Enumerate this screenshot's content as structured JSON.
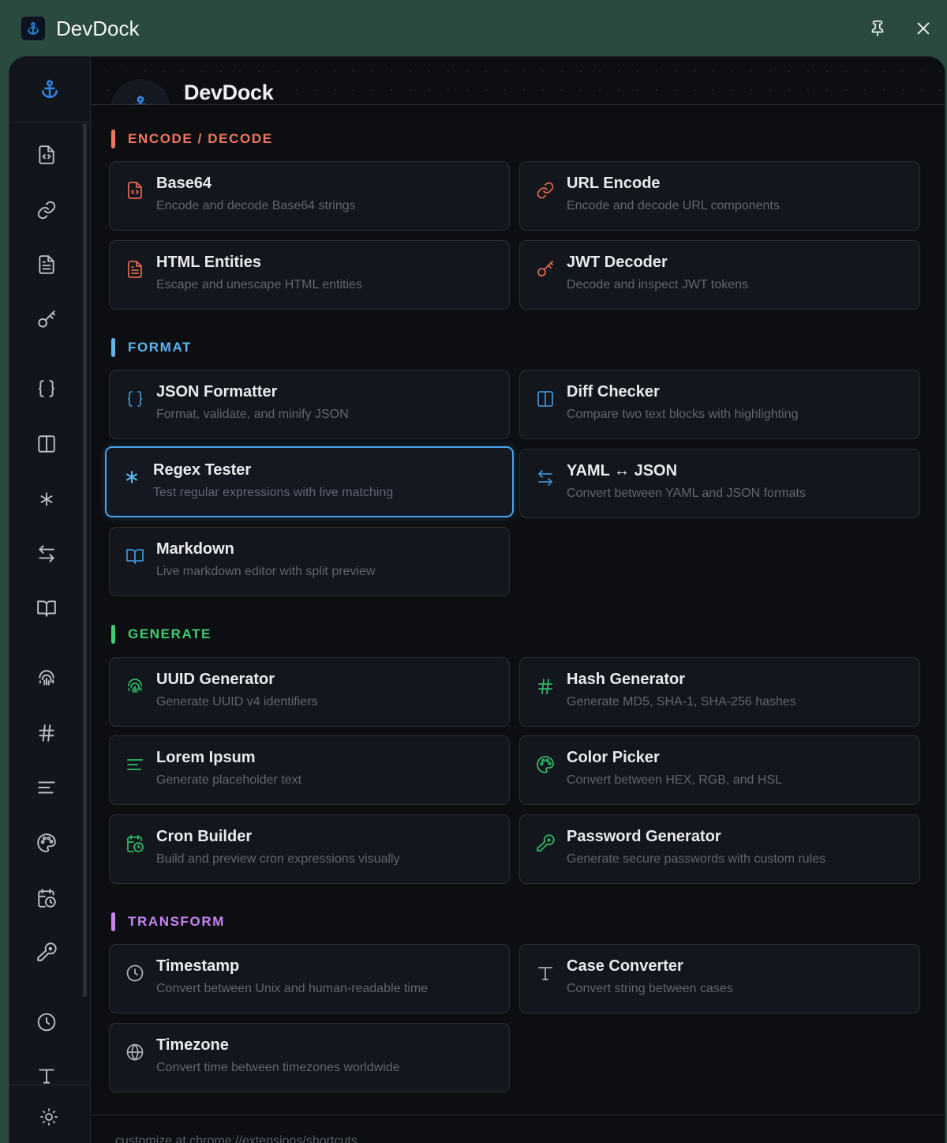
{
  "window": {
    "title": "DevDock",
    "pin_icon": "pin-icon",
    "close_icon": "close-icon"
  },
  "header": {
    "title": "DevDock"
  },
  "sections": {
    "encode": {
      "label": "ENCODE / DECODE",
      "color": "#f0775e"
    },
    "format": {
      "label": "FORMAT",
      "color": "#5cb8f2"
    },
    "generate": {
      "label": "GENERATE",
      "color": "#3ecf70"
    },
    "transform": {
      "label": "TRANSFORM",
      "color": "#c983f3"
    }
  },
  "tools": {
    "base64": {
      "title": "Base64",
      "desc": "Encode and decode Base64 strings",
      "icon": "file-code-icon"
    },
    "url": {
      "title": "URL Encode",
      "desc": "Encode and decode URL components",
      "icon": "link-icon"
    },
    "html": {
      "title": "HTML Entities",
      "desc": "Escape and unescape HTML entities",
      "icon": "file-text-icon"
    },
    "jwt": {
      "title": "JWT Decoder",
      "desc": "Decode and inspect JWT tokens",
      "icon": "key-icon"
    },
    "json": {
      "title": "JSON Formatter",
      "desc": "Format, validate, and minify JSON",
      "icon": "braces-icon"
    },
    "diff": {
      "title": "Diff Checker",
      "desc": "Compare two text blocks with highlighting",
      "icon": "columns-icon"
    },
    "regex": {
      "title": "Regex Tester",
      "desc": "Test regular expressions with live matching",
      "icon": "asterisk-icon"
    },
    "yaml": {
      "title": "YAML ↔ JSON",
      "desc": "Convert between YAML and JSON formats",
      "icon": "arrows-swap-icon"
    },
    "markdown": {
      "title": "Markdown",
      "desc": "Live markdown editor with split preview",
      "icon": "book-icon"
    },
    "uuid": {
      "title": "UUID Generator",
      "desc": "Generate UUID v4 identifiers",
      "icon": "fingerprint-icon"
    },
    "hash": {
      "title": "Hash Generator",
      "desc": "Generate MD5, SHA-1, SHA-256 hashes",
      "icon": "hash-icon"
    },
    "lorem": {
      "title": "Lorem Ipsum",
      "desc": "Generate placeholder text",
      "icon": "text-lines-icon"
    },
    "color": {
      "title": "Color Picker",
      "desc": "Convert between HEX, RGB, and HSL",
      "icon": "palette-icon"
    },
    "cron": {
      "title": "Cron Builder",
      "desc": "Build and preview cron expressions visually",
      "icon": "calendar-clock-icon"
    },
    "password": {
      "title": "Password Generator",
      "desc": "Generate secure passwords with custom rules",
      "icon": "key-round-icon"
    },
    "timestamp": {
      "title": "Timestamp",
      "desc": "Convert between Unix and human-readable time",
      "icon": "clock-icon"
    },
    "case": {
      "title": "Case Converter",
      "desc": "Convert string between cases",
      "icon": "type-icon"
    },
    "timezone": {
      "title": "Timezone",
      "desc": "Convert time between timezones worldwide",
      "icon": "globe-icon"
    }
  },
  "footer": {
    "text": "customize at chrome://extensions/shortcuts"
  },
  "colors": {
    "accent": "#4aa3e6",
    "window_bg": "#2a4a40",
    "panel_bg": "#0c0e12"
  }
}
